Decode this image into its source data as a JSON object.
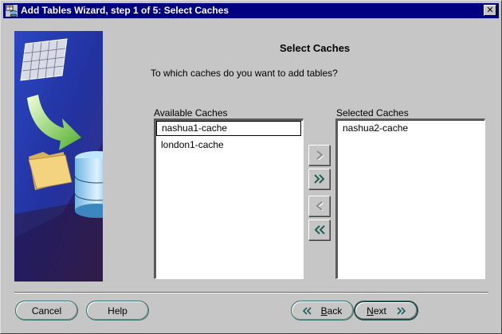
{
  "window": {
    "title": "Add Tables Wizard, step 1 of 5: Select Caches",
    "close_glyph": "✕"
  },
  "page": {
    "heading": "Select Caches",
    "question": "To which caches do you want to add tables?"
  },
  "available": {
    "label": "Available Caches",
    "items": [
      "nashua1-cache",
      "london1-cache"
    ],
    "focused_index": 0
  },
  "selected": {
    "label": "Selected Caches",
    "items": [
      "nashua2-cache"
    ]
  },
  "move_buttons": [
    {
      "icon": "chevron-right-icon",
      "enabled": false
    },
    {
      "icon": "double-chevron-right-icon",
      "enabled": true
    },
    {
      "icon": "chevron-left-icon",
      "enabled": false
    },
    {
      "icon": "double-chevron-left-icon",
      "enabled": true
    }
  ],
  "footer": {
    "cancel": "Cancel",
    "help": "Help",
    "back_mnemonic": "B",
    "back_rest": "ack",
    "next_mnemonic": "N",
    "next_rest": "ext"
  },
  "colors": {
    "titlebar": "#000080",
    "art_background": "#1a1f8a",
    "accent_border": "#2d6f69",
    "arrow_green": "#7cc242"
  }
}
